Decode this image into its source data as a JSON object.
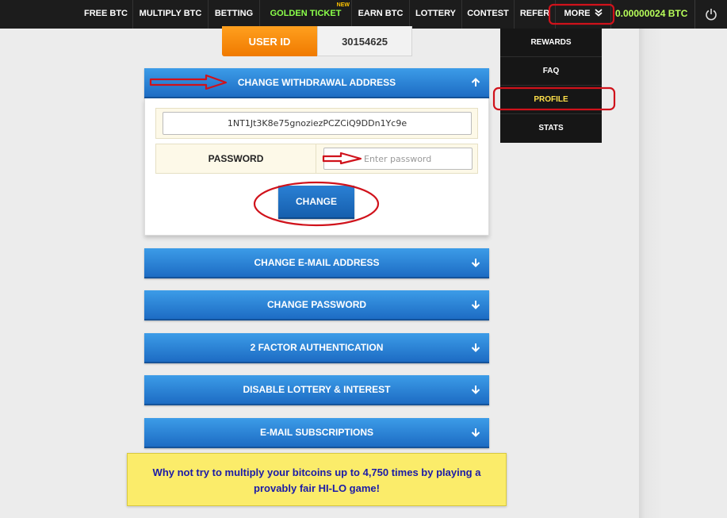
{
  "nav": {
    "items": [
      "FREE BTC",
      "MULTIPLY BTC",
      "BETTING",
      "GOLDEN TICKET",
      "EARN BTC",
      "LOTTERY",
      "CONTEST",
      "REFER"
    ],
    "new_badge": "NEW",
    "more_label": "MORE",
    "balance": "0.00000024 BTC"
  },
  "dropdown": {
    "items": [
      "REWARDS",
      "FAQ",
      "PROFILE",
      "STATS"
    ]
  },
  "user": {
    "id_label": "USER ID",
    "id_value": "30154625"
  },
  "withdrawal": {
    "title": "CHANGE WITHDRAWAL ADDRESS",
    "address": "1NT1Jt3K8e75gnoziezPCZCiQ9DDn1Yc9e",
    "password_label": "PASSWORD",
    "password_placeholder": "Enter password",
    "change_button": "CHANGE"
  },
  "sections": [
    "CHANGE E-MAIL ADDRESS",
    "CHANGE PASSWORD",
    "2 FACTOR AUTHENTICATION",
    "DISABLE LOTTERY & INTEREST",
    "E-MAIL SUBSCRIPTIONS"
  ],
  "promo": "Why not try to multiply your bitcoins up to 4,750 times by playing a provably fair HI-LO game!",
  "colors": {
    "nav_bg": "#1c1c1c",
    "accent_blue": "#1d6cc4",
    "user_id_orange": "#f07a00",
    "golden_ticket": "#8bff4a",
    "balance": "#b8ff5a",
    "promo_bg": "#fbec6a",
    "annotation_red": "#d0121b"
  }
}
